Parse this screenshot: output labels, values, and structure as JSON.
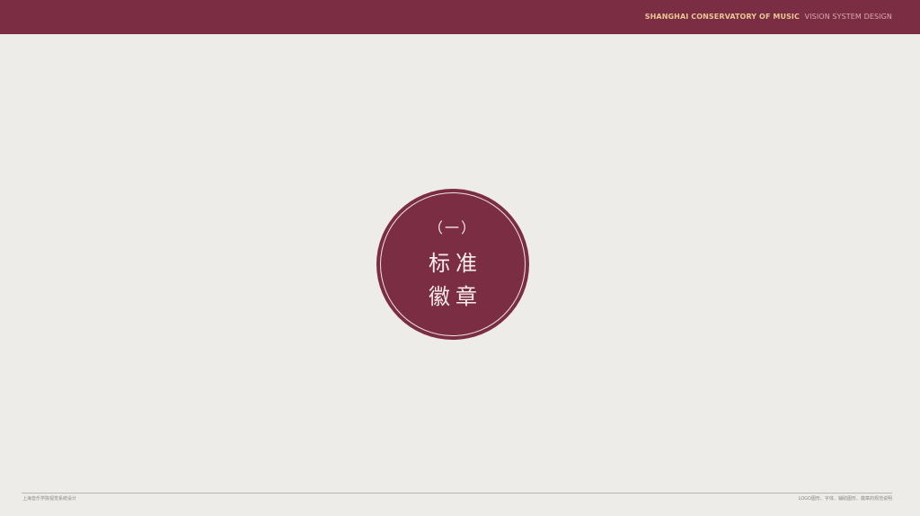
{
  "header": {
    "brand": "SHANGHAI CONSERVATORY OF MUSIC",
    "subtitle": "VISION SYSTEM DESIGN"
  },
  "emblem": {
    "number": "（一）",
    "title_line1": "标准",
    "title_line2": "徽章"
  },
  "footer": {
    "left": "上海音乐学院视觉系统设计",
    "right": "LOGO图形、字体、辅助图形、徽章的规范说明"
  },
  "colors": {
    "primary": "#7b2d43",
    "background": "#edece8",
    "brand_text": "#e9c893"
  }
}
